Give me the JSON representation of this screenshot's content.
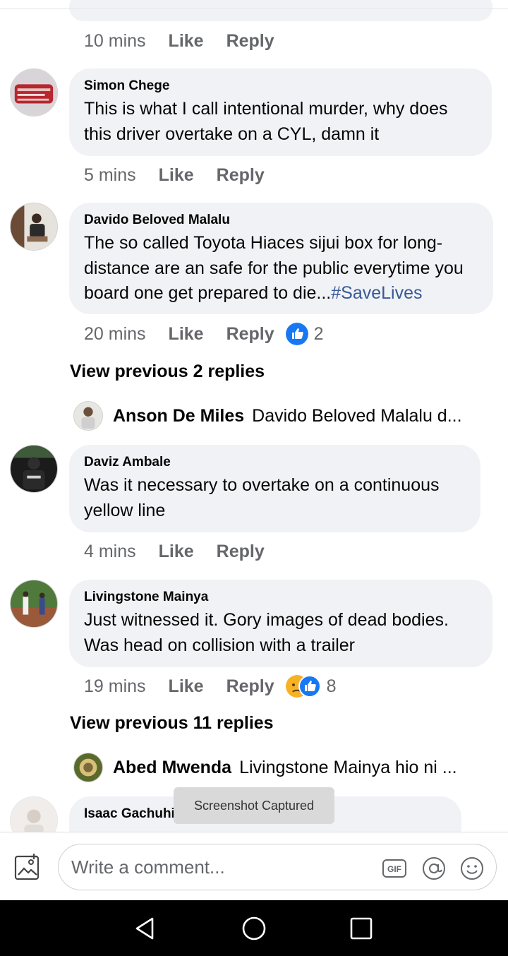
{
  "comments": [
    {
      "author": "Simon Chege",
      "text": "This is what I call intentional murder, why does this driver overtake on a CYL, damn it",
      "time": "5 mins",
      "like": "Like",
      "reply": "Reply"
    },
    {
      "author": "Davido Beloved Malalu",
      "text": "The so called Toyota Hiaces sijui box for long-distance are an safe for the public everytime you board one get prepared to die...",
      "hashtag": "#SaveLives",
      "time": "20 mins",
      "like": "Like",
      "reply": "Reply",
      "reaction_count": "2",
      "reactions": [
        "like-icon"
      ],
      "view_previous": "View previous 2 replies",
      "latest_reply": {
        "author": "Anson De Miles",
        "text": "Davido Beloved Malalu d..."
      }
    },
    {
      "author": "Daviz Ambale",
      "text": "Was it necessary to overtake on a continuous yellow line",
      "time": "4 mins",
      "like": "Like",
      "reply": "Reply"
    },
    {
      "author": "Livingstone Mainya",
      "text": "Just witnessed it. Gory images of dead bodies. Was head on collision with a trailer",
      "time": "19 mins",
      "like": "Like",
      "reply": "Reply",
      "reaction_count": "8",
      "reactions": [
        "sad-icon",
        "like-icon"
      ],
      "view_previous": "View previous 11 replies",
      "latest_reply": {
        "author": "Abed Mwenda",
        "text": "Livingstone Mainya hio ni ..."
      }
    },
    {
      "author": "Isaac Gachuhi"
    }
  ],
  "top_meta": {
    "time": "10 mins",
    "like": "Like",
    "reply": "Reply"
  },
  "toast": "Screenshot Captured",
  "composer": {
    "placeholder": "Write a comment...",
    "icons": [
      "gallery-icon",
      "gif-icon",
      "mention-icon",
      "emoji-icon"
    ]
  },
  "navbar": {
    "icons": [
      "back-icon",
      "home-icon",
      "recents-icon"
    ]
  },
  "colors": {
    "bubble": "#f0f2f5",
    "meta": "#65676b",
    "hashtag": "#385898",
    "like_blue": "#1877f2",
    "navbar": "#000000"
  }
}
